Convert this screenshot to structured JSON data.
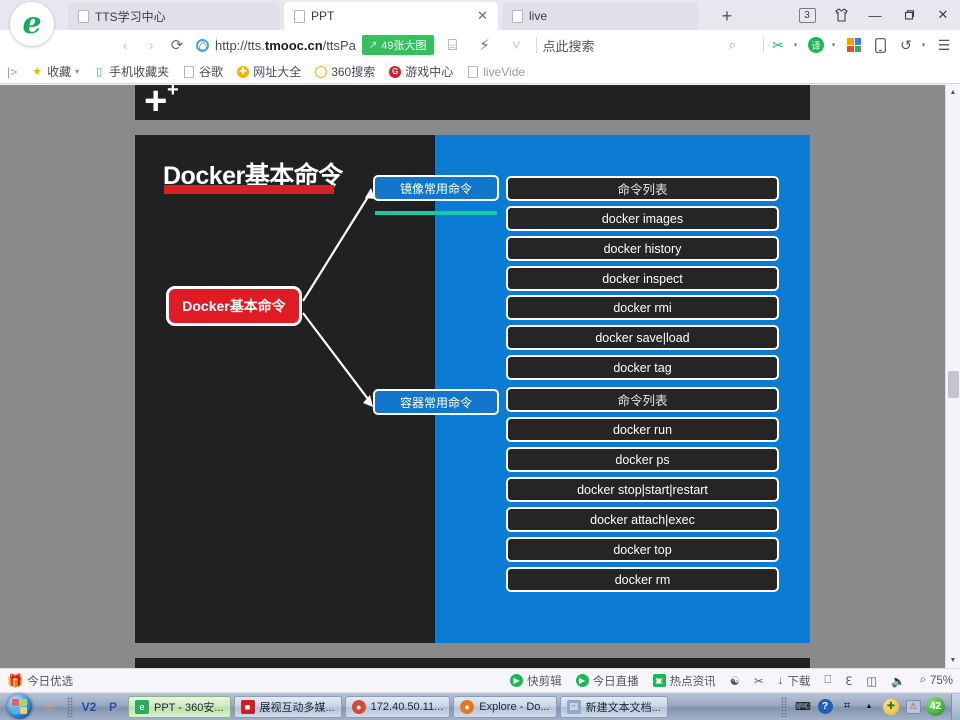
{
  "browser": {
    "logo": "e-logo-icon",
    "tabs": [
      {
        "title": "TTS学习中心",
        "active": false,
        "closable": false
      },
      {
        "title": "PPT",
        "active": true,
        "closable": true
      },
      {
        "title": "live",
        "active": false,
        "closable": false
      }
    ],
    "new_tab_label": "+",
    "tab_count": "3",
    "window_controls": {
      "minimize": "—",
      "maximize": "❐",
      "close": "✕"
    },
    "nav": {
      "back": "‹",
      "forward": "›",
      "reload": "⟳",
      "home": "⌂",
      "url": "http://tts.",
      "url_bold": "tmooc.cn",
      "url_rest": "/ttsPa",
      "bigpic_badge": "49张大图",
      "bigpic_icon": "expand-icon",
      "qr_icon": "⌸",
      "lightning_icon": "⚡",
      "chevron_icon": "˅",
      "search_placeholder": "点此搜索",
      "search_icon": "⌕"
    },
    "right_tools": {
      "scissors": "✂",
      "translate": "译",
      "apps": "apps-grid-icon",
      "phone": "⎕",
      "undo": "↺",
      "menu": "☰"
    },
    "bookmarks": {
      "overflow": "|>",
      "items": [
        {
          "label": "收藏",
          "icon": "star-icon",
          "caret": "˅"
        },
        {
          "label": "手机收藏夹",
          "icon": "phone-icon"
        },
        {
          "label": "谷歌",
          "icon": "doc-icon"
        },
        {
          "label": "网址大全",
          "icon": "plus-circle-icon"
        },
        {
          "label": "360搜索",
          "icon": "circle-icon"
        },
        {
          "label": "游戏中心",
          "icon": "g-circle-icon"
        },
        {
          "label": "liveVide",
          "icon": "doc-icon"
        }
      ]
    },
    "status_bar": {
      "left_item": {
        "label": "今日优选",
        "icon": "gift-icon"
      },
      "items": [
        {
          "label": "快剪辑",
          "icon": "play-circle-icon"
        },
        {
          "label": "今日直播",
          "icon": "play-circle-icon"
        },
        {
          "label": "热点资讯",
          "icon": "news-icon"
        }
      ],
      "icons": [
        "compass-icon",
        "mute-icon"
      ],
      "download_label": "下载",
      "download_icon": "↓",
      "extra_icons": [
        "window-icon",
        "browser-icon",
        "sidebar-icon",
        "volume-icon"
      ],
      "zoom_icon": "⌕",
      "zoom_level": "75%"
    },
    "scrollbar": {
      "up": "▲",
      "down": "▼"
    }
  },
  "slide": {
    "title": "Docker基本命令",
    "root_node": "Docker基本命令",
    "branches": [
      {
        "label": "镜像常用命令"
      },
      {
        "label": "容器常用命令"
      }
    ],
    "image_commands": [
      "命令列表",
      "docker images",
      "docker history",
      "docker inspect",
      "docker rmi",
      "docker save|load",
      "docker tag"
    ],
    "container_commands": [
      "命令列表",
      "docker run",
      "docker ps",
      "docker stop|start|restart",
      "docker attach|exec",
      "docker top",
      "docker rm"
    ],
    "colors": {
      "background": "#222122",
      "panel_blue": "#0b7bd4",
      "root_red": "#e01b24",
      "rule_red": "#d91f26",
      "branch_blue": "#1277cc",
      "underline_teal": "#19c9a6",
      "box_dark": "#262425",
      "border_white": "#ffffff"
    },
    "prev_slide_marks": {
      "big": "+",
      "small": "+"
    }
  },
  "taskbar": {
    "start": "windows-orb-icon",
    "quick_launch": [
      {
        "icon": "media-icon",
        "name": "media-player"
      },
      {
        "icon": "V2",
        "name": "vegas"
      },
      {
        "icon": "P",
        "name": "powerpoint-like"
      }
    ],
    "buttons": [
      {
        "label": "PPT - 360安...",
        "icon": "e",
        "icon_color": "#2fa85f",
        "active": true
      },
      {
        "label": "展视互动多媒...",
        "icon": "■",
        "icon_color": "#cf2020",
        "active": false
      },
      {
        "label": "172.40.50.11...",
        "icon": "●",
        "icon_color": "#d44a3a",
        "active": false
      },
      {
        "label": "Explore - Do...",
        "icon": "●",
        "icon_color": "#e8761e",
        "active": false
      },
      {
        "label": "新建文本文档...",
        "icon": "▤",
        "icon_color": "#8fa8cc",
        "active": false
      }
    ],
    "tray": {
      "keyboard": "⌨",
      "help": "?",
      "network": "⌗",
      "chevron": "▲",
      "shield": "⊕",
      "security": "⌘",
      "badge": "42"
    }
  }
}
